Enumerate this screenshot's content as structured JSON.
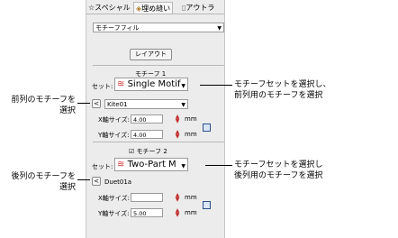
{
  "tabs": [
    {
      "label": "スペシャル",
      "icon": "star-icon"
    },
    {
      "label": "埋め縫い",
      "icon": "fill-stitch-icon"
    },
    {
      "label": "アウトラ",
      "icon": "outline-icon"
    }
  ],
  "top_select": "モチーフフィル",
  "layout_button": "レイアウト",
  "motif1": {
    "header": "モチーフ 1",
    "set_label": "セット:",
    "set_value": "Single Motif",
    "motif_value": "Kite01",
    "x_label": "X軸サイズ:",
    "x_value": "4.00",
    "y_label": "Y軸サイズ:",
    "y_value": "4.00",
    "unit": "mm"
  },
  "motif2": {
    "checkbox_label": "モチーフ 2",
    "set_label": "セット:",
    "set_value": "Two-Part M",
    "motif_value": "Duet01a",
    "x_label": "X軸サイズ:",
    "x_value": "",
    "y_label": "Y軸サイズ:",
    "y_value": "5.00",
    "unit": "mm"
  },
  "annotations": {
    "right1_line1": "モチーフセットを選択し、",
    "right1_line2": "前列用のモチーフを選択",
    "left1_line1": "前列のモチーフを",
    "left1_line2": "選択",
    "right2_line1": "モチーフセットを選択し",
    "right2_line2": "後列用のモチーフを選択",
    "left2_line1": "後列のモチーフを",
    "left2_line2": "選択"
  }
}
